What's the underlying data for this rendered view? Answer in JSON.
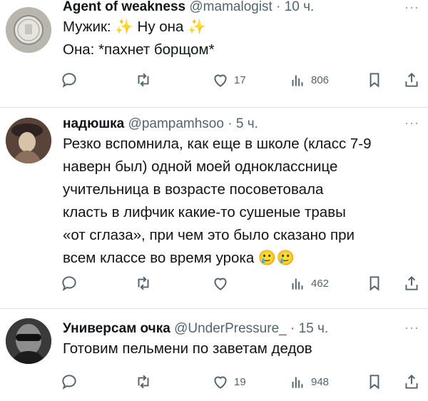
{
  "tweets": [
    {
      "name": "Agent of weakness",
      "handle": "@mamalogist",
      "time": "10 ч.",
      "more": "···",
      "lines": [
        "Мужик: ✨ Ну она ✨",
        "Она: *пахнет борщом*"
      ],
      "reply_count": "",
      "retweet_count": "",
      "like_count": "17",
      "view_count": "806"
    },
    {
      "name": "надюшка",
      "handle": "@pampamhsoo",
      "time": "5 ч.",
      "more": "···",
      "lines": [
        "Резко вспомнила, как еще в школе (класс 7-9",
        "наверн был) одной моей однокласснице",
        "учительница в возрасте посоветовала",
        "класть в лифчик какие-то сушеные травы",
        "«от сглаза», при чем это было сказано при",
        "всем классе во время урока 🥲🥲"
      ],
      "reply_count": "",
      "retweet_count": "",
      "like_count": "",
      "view_count": "462"
    },
    {
      "name": "Универсам очка",
      "handle": "@UnderPressure_",
      "time": "15 ч.",
      "more": "···",
      "lines": [
        "Готовим пельмени по заветам дедов"
      ],
      "reply_count": "",
      "retweet_count": "",
      "like_count": "19",
      "view_count": "948"
    }
  ],
  "icons": [
    "reply-icon",
    "retweet-icon",
    "like-icon",
    "views-icon",
    "bookmark-icon",
    "share-icon"
  ],
  "colors": {
    "text": "#0f1419",
    "secondary": "#536471",
    "divider": "#e1e5e8"
  }
}
